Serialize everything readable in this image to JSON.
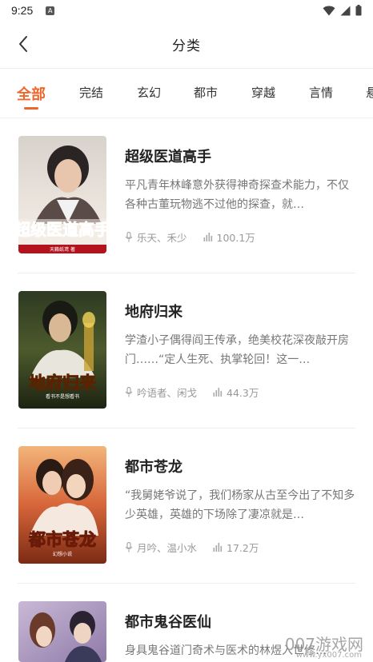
{
  "status_bar": {
    "time": "9:25",
    "notif_icon_letter": "A",
    "icons": [
      "wifi-icon",
      "signal-icon",
      "battery-icon"
    ]
  },
  "header": {
    "title": "分类",
    "back_icon": "chevron-left-icon"
  },
  "tabs": [
    {
      "label": "全部",
      "active": true
    },
    {
      "label": "完结"
    },
    {
      "label": "玄幻"
    },
    {
      "label": "都市"
    },
    {
      "label": "穿越"
    },
    {
      "label": "言情"
    },
    {
      "label": "悬"
    }
  ],
  "books": [
    {
      "title": "超级医道高手",
      "description": "平凡青年林峰意外获得神奇探查术能力，不仅各种古董玩物逃不过他的探查，就…",
      "authors": "乐天、禾少",
      "plays": "100.1万",
      "cover_text": "超级医道高手",
      "cover_sub": "天籁纸鸢 著"
    },
    {
      "title": "地府归来",
      "description": "学渣小子偶得阎王传承，绝美校花深夜敲开房门……“定人生死、执掌轮回！这一…",
      "authors": "吟语者、闲戈",
      "plays": "44.3万",
      "cover_text": "地府归来",
      "cover_sub": "看书不是想看书"
    },
    {
      "title": "都市苍龙",
      "description": "“我舅姥爷说了，我们杨家从古至今出了不知多少英雄，英雄的下场除了凄凉就是…",
      "authors": "月吟、温小水",
      "plays": "17.2万",
      "cover_text": "都市苍龙",
      "cover_sub": "幻想小说"
    },
    {
      "title": "都市鬼谷医仙",
      "description": "身具鬼谷道门奇术与医术的林煜入世修…",
      "authors": "",
      "plays": "",
      "cover_text": "",
      "cover_sub": ""
    }
  ],
  "watermark": {
    "text": "007游戏网",
    "sub": "www.yx007.com"
  },
  "colors": {
    "accent": "#f0652a",
    "text_primary": "#222222",
    "text_secondary": "#777777",
    "text_meta": "#999999"
  }
}
